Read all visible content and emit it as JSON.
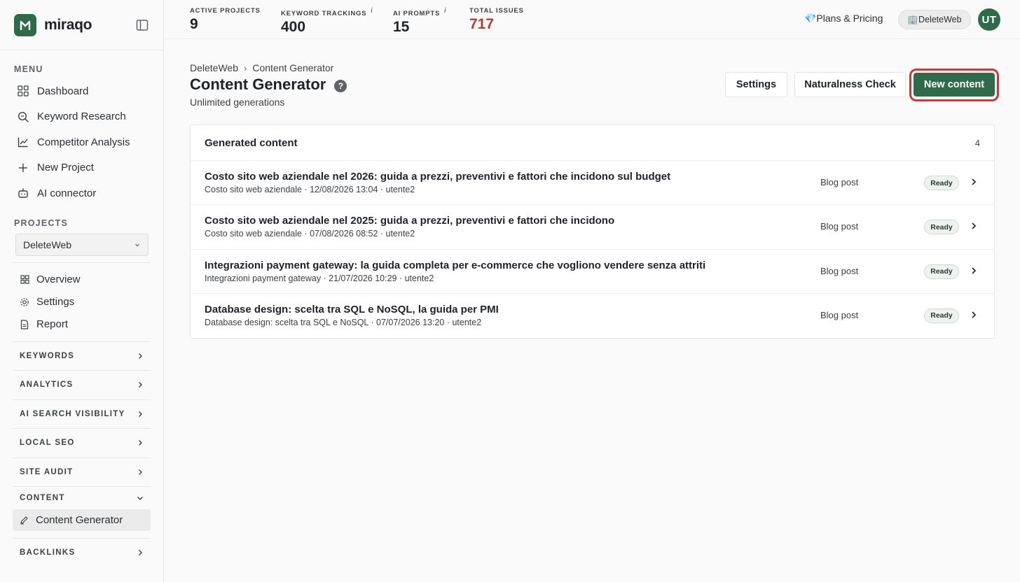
{
  "brand": {
    "name": "miraqo"
  },
  "menu": {
    "label": "MENU",
    "items": [
      {
        "label": "Dashboard",
        "icon": "grid-icon"
      },
      {
        "label": "Keyword Research",
        "icon": "search-icon"
      },
      {
        "label": "Competitor Analysis",
        "icon": "chart-line-icon"
      },
      {
        "label": "New Project",
        "icon": "plus-icon"
      },
      {
        "label": "AI connector",
        "icon": "robot-icon"
      }
    ]
  },
  "projects": {
    "label": "PROJECTS",
    "selected": "DeleteWeb",
    "items": [
      {
        "label": "Overview",
        "icon": "grid-icon"
      },
      {
        "label": "Settings",
        "icon": "gear-icon"
      },
      {
        "label": "Report",
        "icon": "document-icon"
      }
    ]
  },
  "groups": {
    "keywords": "KEYWORDS",
    "analytics": "ANALYTICS",
    "ai_search_visibility": "AI SEARCH VISIBILITY",
    "local_seo": "LOCAL SEO",
    "site_audit": "SITE AUDIT",
    "content": "CONTENT",
    "content_active_item": "Content Generator",
    "backlinks": "BACKLINKS"
  },
  "stats": [
    {
      "label": "ACTIVE PROJECTS",
      "value": "9",
      "info": ""
    },
    {
      "label": "KEYWORD TRACKINGS",
      "value": "400",
      "info": "i"
    },
    {
      "label": "AI PROMPTS",
      "value": "15",
      "info": "i"
    },
    {
      "label": "TOTAL ISSUES",
      "value": "717",
      "info": ""
    }
  ],
  "topbar": {
    "plans": "💎Plans & Pricing",
    "workspace": "🏢DeleteWeb",
    "avatar": "UT"
  },
  "page": {
    "breadcrumb": [
      "DeleteWeb",
      "Content Generator"
    ],
    "title": "Content Generator",
    "subtitle": "Unlimited generations",
    "help": "?",
    "buttons": {
      "settings": "Settings",
      "naturalness": "Naturalness Check",
      "new_content": "New content"
    }
  },
  "generated": {
    "title": "Generated content",
    "count": "4",
    "rows": [
      {
        "title": "Costo sito web aziendale nel 2026: guida a prezzi, preventivi e fattori che incidono sul budget",
        "meta": "Costo sito web aziendale · 12/08/2026 13:04 · utente2",
        "type": "Blog post",
        "status": "Ready"
      },
      {
        "title": "Costo sito web aziendale nel 2025: guida a prezzi, preventivi e fattori che incidono",
        "meta": "Costo sito web aziendale · 07/08/2026 08:52 · utente2",
        "type": "Blog post",
        "status": "Ready"
      },
      {
        "title": "Integrazioni payment gateway: la guida completa per e-commerce che vogliono vendere senza attriti",
        "meta": "Integrazioni payment gateway · 21/07/2026 10:29 · utente2",
        "type": "Blog post",
        "status": "Ready"
      },
      {
        "title": "Database design: scelta tra SQL e NoSQL, la guida per PMI",
        "meta": "Database design: scelta tra SQL e NoSQL · 07/07/2026 13:20 · utente2",
        "type": "Blog post",
        "status": "Ready"
      }
    ]
  },
  "colors": {
    "brand": "#2f6b4a",
    "issues": "#b43c33",
    "highlight_ring": "#c43a3a"
  }
}
